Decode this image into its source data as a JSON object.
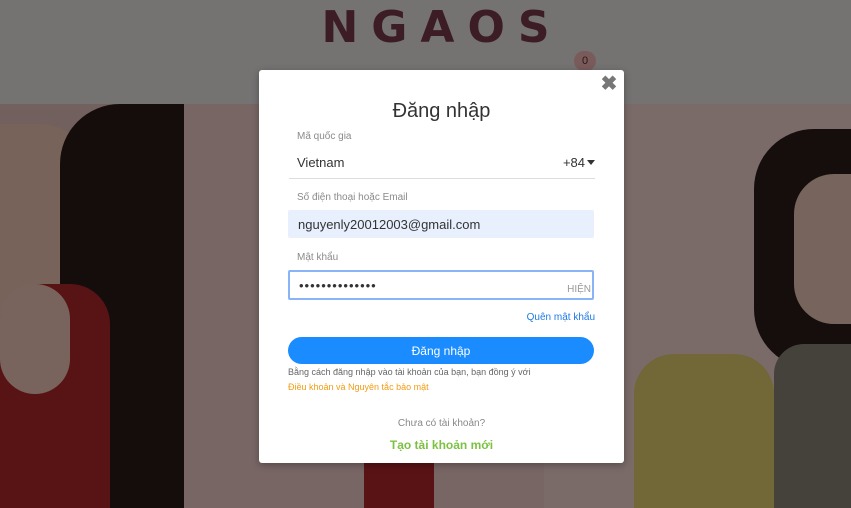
{
  "background": {
    "logo": "NGAOS",
    "cart_count": "0"
  },
  "modal": {
    "title": "Đăng nhập",
    "close_icon": "close-icon",
    "country": {
      "label": "Mã quốc gia",
      "name": "Vietnam",
      "code": "+84"
    },
    "email": {
      "label": "Số điện thoại hoặc Email",
      "value": "nguyenly20012003@gmail.com"
    },
    "password": {
      "label": "Mật khẩu",
      "value": "••••••••••••••",
      "show_label": "HIỆN"
    },
    "forgot": "Quên mật khẩu",
    "login_button": "Đăng nhập",
    "terms_text": "Bằng cách đăng nhập vào tài khoản của bạn, bạn đồng ý với",
    "terms_link": "Điều khoản và Nguyên tắc bảo mật",
    "no_account": "Chưa có tài khoản?",
    "create_account": "Tạo tài khoản mới"
  },
  "colors": {
    "primary": "#1a8cff",
    "link": "#1e7ae6",
    "terms": "#f39c12",
    "create": "#7cc242"
  }
}
